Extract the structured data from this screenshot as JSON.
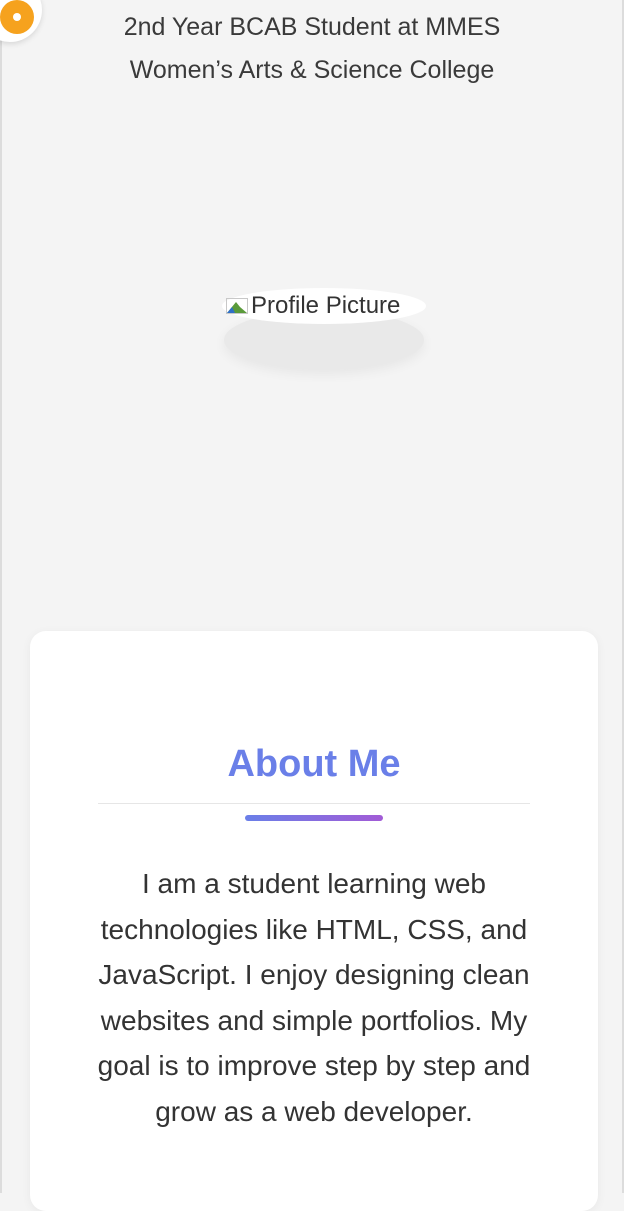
{
  "hero": {
    "subtitle": "2nd Year BCAB Student at MMES Women’s Arts & Science College"
  },
  "profile": {
    "image_alt": "Profile Picture"
  },
  "about": {
    "title": "About Me",
    "text": "I am a student learning web technologies like HTML, CSS, and JavaScript. I enjoy designing clean websites and simple portfolios. My goal is to improve step by step and grow as a web developer."
  },
  "colors": {
    "background": "#f4f4f4",
    "accent": "#6a7fe8",
    "accent_secondary": "#a25bd6",
    "fab": "#f6a21e"
  },
  "icons": {
    "fab": "theme-toggle-icon",
    "profile": "broken-image-icon"
  }
}
